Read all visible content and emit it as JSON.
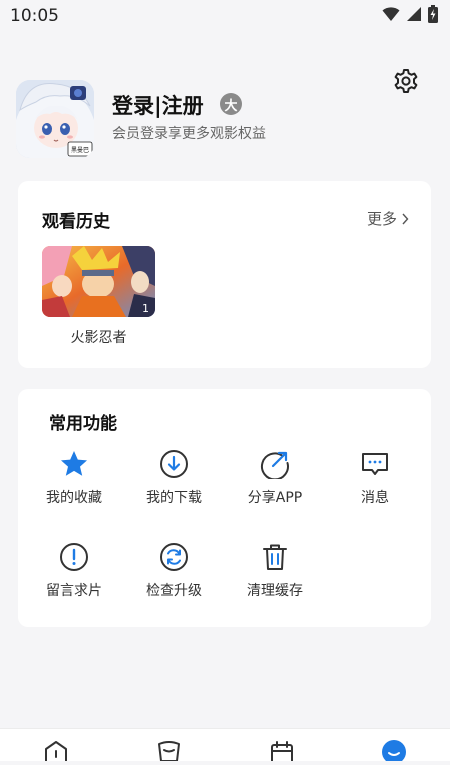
{
  "status_bar": {
    "time": "10:05"
  },
  "profile": {
    "title": "登录|注册",
    "badge": "大",
    "subtitle": "会员登录享更多观影权益",
    "avatar_stamp": "黑曼巴"
  },
  "history": {
    "title": "观看历史",
    "more": "更多",
    "items": [
      {
        "title": "火影忍者",
        "episode": "1"
      }
    ]
  },
  "functions": {
    "title": "常用功能",
    "items": [
      {
        "label": "我的收藏",
        "icon": "star-icon"
      },
      {
        "label": "我的下载",
        "icon": "download-icon"
      },
      {
        "label": "分享APP",
        "icon": "share-icon"
      },
      {
        "label": "消息",
        "icon": "message-icon"
      },
      {
        "label": "留言求片",
        "icon": "exclamation-circle-icon"
      },
      {
        "label": "检查升级",
        "icon": "refresh-icon"
      },
      {
        "label": "清理缓存",
        "icon": "trash-icon"
      }
    ]
  },
  "tabbar": {
    "items": [
      {
        "icon": "home-icon"
      },
      {
        "icon": "cup-icon"
      },
      {
        "icon": "calendar-icon"
      },
      {
        "icon": "profile-icon",
        "active": true
      }
    ]
  },
  "colors": {
    "accent": "#1e7be4",
    "background": "#f5f5f7",
    "card": "#ffffff"
  }
}
